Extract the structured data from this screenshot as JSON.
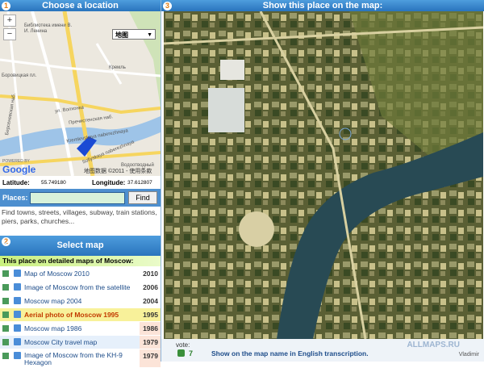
{
  "step1": {
    "number": "1",
    "title": "Choose a location"
  },
  "step2": {
    "number": "2",
    "title": "Select map"
  },
  "step3": {
    "number": "3",
    "title": "Show this place on the map:"
  },
  "google_map": {
    "zoom_in": "+",
    "zoom_out": "−",
    "type_select": "地图",
    "labels": {
      "metro1": "Библиотека имени В. И. Ленина",
      "kremlin": "Кремль",
      "borovitskaya": "Боровицкая пл.",
      "volkhonka": "ул. Волхонка",
      "prechistenka": "Пречистенская наб.",
      "kremlevskaya": "Kremlevskaya naberezhnaya",
      "sofiyskaya": "Sofiyskaya naberezhnaya",
      "bersenevskaya": "Берсеневская наб.",
      "vodootvodny": "Водоотводный"
    },
    "powered_by": "POWERED BY",
    "google": "Google",
    "copyright": "地图数据 ©2011 - 使用条款"
  },
  "coords": {
    "lat_label": "Latitude:",
    "lat": "55.749180",
    "lon_label": "Longitude:",
    "lon": "37.612807"
  },
  "places": {
    "label": "Places:",
    "value": "",
    "find": "Find"
  },
  "hint": "Find towns, streets, villages, subway, train stations, piers, parks, churches...",
  "maps_title": "This place on detailed maps of Moscow:",
  "maps": [
    {
      "title": "Map of Moscow 2010",
      "year": "2010",
      "highlight": false
    },
    {
      "title": "Image of Moscow from the satellite",
      "year": "2006",
      "highlight": false
    },
    {
      "title": "Moscow map 2004",
      "year": "2004",
      "highlight": false
    },
    {
      "title": "Aerial photo of Moscow 1995",
      "year": "1995",
      "highlight": true
    },
    {
      "title": "Moscow map 1986",
      "year": "1986",
      "highlight": false
    },
    {
      "title": "Moscow City travel map",
      "year": "1979",
      "highlight": false
    },
    {
      "title": "Image of Moscow from the KH-9 Hexagon",
      "year": "1979",
      "highlight": false
    }
  ],
  "footer": {
    "vote_label": "vote:",
    "vote_count": "7",
    "text": "Show on the map name in English transcription.",
    "watermark1": "ALLMAPS.RU",
    "watermark2": "Vladimir"
  }
}
